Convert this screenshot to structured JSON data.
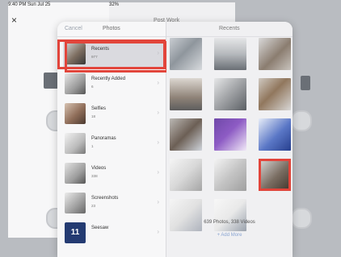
{
  "statusbar": {
    "time_date": "9:40 PM  Sun Jul 25",
    "battery": "32%"
  },
  "close_icon": "×",
  "bg_title": "Post Work",
  "picker": {
    "cancel_label": "Cancel",
    "photos_title": "Photos",
    "recents_title": "Recents",
    "albums": [
      {
        "name": "Recents",
        "count": "977"
      },
      {
        "name": "Recently Added",
        "count": "6"
      },
      {
        "name": "Selfies",
        "count": "18"
      },
      {
        "name": "Panoramas",
        "count": "1"
      },
      {
        "name": "Videos",
        "count": "338"
      },
      {
        "name": "Screenshots",
        "count": "23"
      },
      {
        "name": "Seesaw",
        "count": ""
      }
    ],
    "summary": "639 Photos, 338 Videos",
    "add_more_label": "+ Add More"
  },
  "colors": {
    "highlight": "#e2453b",
    "accent": "#8aa5d2"
  }
}
